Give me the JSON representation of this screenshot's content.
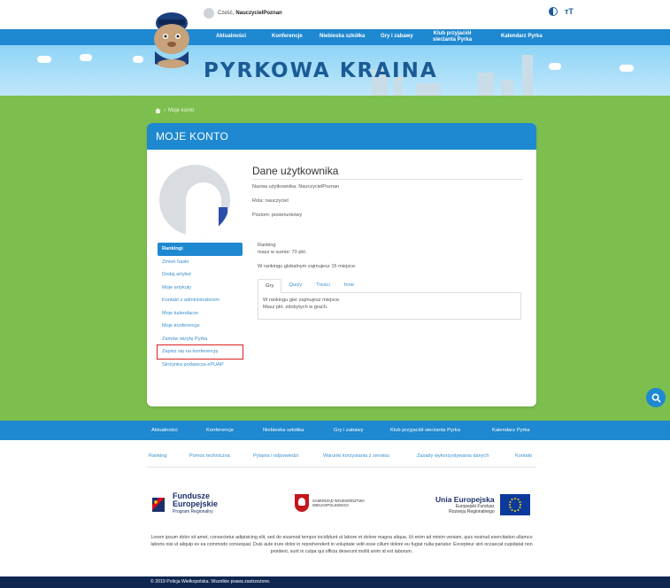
{
  "header": {
    "greeting": "Cześć,",
    "username": "NauczycielPoznan",
    "brand": "PYRKOWA KRAINA",
    "contrast_icon": "contrast-icon",
    "font_size_icon": "font-size-icon"
  },
  "nav": {
    "items": [
      "Aktualności",
      "Konferencje",
      "Niebieska szkółka",
      "Gry i zabawy",
      "Klub przyjaciół",
      "sierżanta Pyrka",
      "Kalendarz Pyrka"
    ]
  },
  "breadcrumb": {
    "icon": "home-icon",
    "label": "Moje konto"
  },
  "account": {
    "heading": "MOJE KONTO",
    "section_title": "Dane użytkownika",
    "username_line": "Nazwa użytkownika: NauczycielPoznan",
    "role_line": "Rola: nauczyciel",
    "level_line": "Poziom: posterunkowy",
    "ranking_title": "Ranking",
    "ranking_sum": "masz w sumie: 70 pkt.",
    "ranking_global": "W rankingu globalnym zajmujesz 15 miejsce.",
    "tabs": [
      "Gry",
      "Quizy",
      "Treści",
      "Inne"
    ],
    "tab_text_1": "W rankingu gier zajmujesz miejsce.",
    "tab_text_2": "Masz pkt. zdobytych w grach."
  },
  "menu": {
    "items": [
      "Rankingi",
      "Zmień hasło",
      "Dodaj artykuł",
      "Moje artykuły",
      "Kontakt z administratorem",
      "Moje kalendarze",
      "Moje konferencje",
      "Zamów wizytę Pyrka",
      "Zapisz się na konferencję",
      "Skrzynka podawcza ePUAP"
    ]
  },
  "search_icon": "search-icon",
  "footer_nav": {
    "items": [
      "Aktualności",
      "Konferencje",
      "Niebieska szkółka",
      "Gry i zabawy",
      "Klub przyjaciół sierżanta Pyrka",
      "Kalendarz Pyrka"
    ]
  },
  "footer_links": {
    "items": [
      "Ranking",
      "Pomoc techniczna",
      "Pytania i odpowiedzi",
      "Warunki korzystania z serwisu",
      "Zasady wykorzystywania danych",
      "Kontakt"
    ]
  },
  "logos": {
    "fe_title_1": "Fundusze",
    "fe_title_2": "Europejskie",
    "fe_sub": "Program Regionalny",
    "sw_line_1": "SAMORZĄD WOJEWÓDZTWA",
    "sw_line_2": "WIELKOPOLSKIEGO",
    "ue_title": "Unia Europejska",
    "ue_sub_1": "Europejski Fundusz",
    "ue_sub_2": "Rozwoju Regionalnego"
  },
  "lorem": "Lorem ipsum dolor sit amet, consectetur adipisicing elit, sed do eiusmod tempor incididunt ut labore et dolore magna aliqua. Ut enim ad minim veniam, quis nostrud exercitation ullamco laboris nisi ut aliquip ex ea commodo consequat. Duis aute irure dolor in reprehenderit in voluptate velit esse cillum dolore eu fugiat nulla pariatur. Excepteur sint occaecat cupidatat non proident, sunt in culpa qui officia deserunt mollit anim id est laborum.",
  "copyright": "© 2019 Policja Wielkopolska. Wszelkie prawa zastrzeżone.",
  "colors": {
    "primary": "#1e88d0",
    "green": "#7dbf4e",
    "dark": "#0f2750",
    "highlight": "#e02020"
  }
}
